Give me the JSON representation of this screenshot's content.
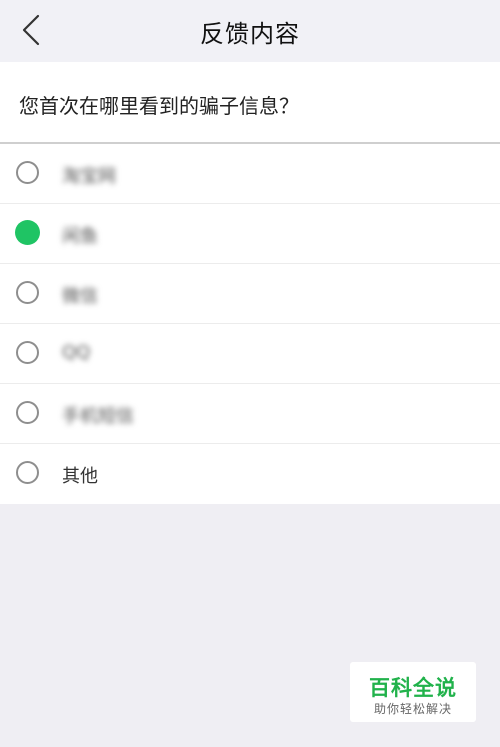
{
  "header": {
    "title": "反馈内容",
    "back_icon": "chevron-left-icon"
  },
  "question": {
    "text": "您首次在哪里看到的骗子信息？"
  },
  "options": [
    {
      "label": "淘宝网",
      "selected": false
    },
    {
      "label": "闲鱼",
      "selected": true
    },
    {
      "label": "微信",
      "selected": false
    },
    {
      "label": "QQ",
      "selected": false
    },
    {
      "label": "手机短信",
      "selected": false
    },
    {
      "label": "其他",
      "selected": false
    }
  ],
  "watermark": {
    "title": "百科全说",
    "subtitle": "助你轻松解决"
  },
  "colors": {
    "accent": "#1fc464",
    "watermark_green": "#21b24b",
    "background": "#efeef3"
  }
}
